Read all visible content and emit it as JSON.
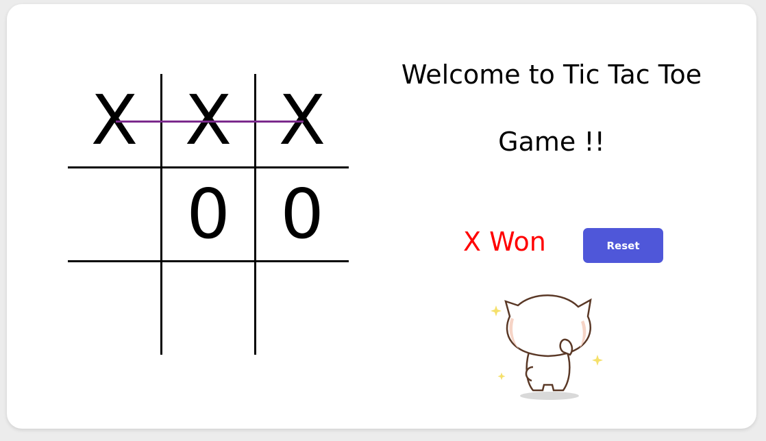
{
  "game": {
    "title": "Welcome to Tic Tac Toe Game !!",
    "status": "X Won",
    "reset_label": "Reset",
    "board": [
      "X",
      "X",
      "X",
      "",
      "0",
      "0",
      "",
      "",
      ""
    ],
    "winning_line": "top-row"
  },
  "colors": {
    "status": "#ff0000",
    "reset_button": "#4f57d9",
    "win_line": "#7b2a8c",
    "grid": "#000000"
  },
  "icons": {
    "celebration": "cat-icon",
    "sparkle": "sparkle-icon"
  }
}
